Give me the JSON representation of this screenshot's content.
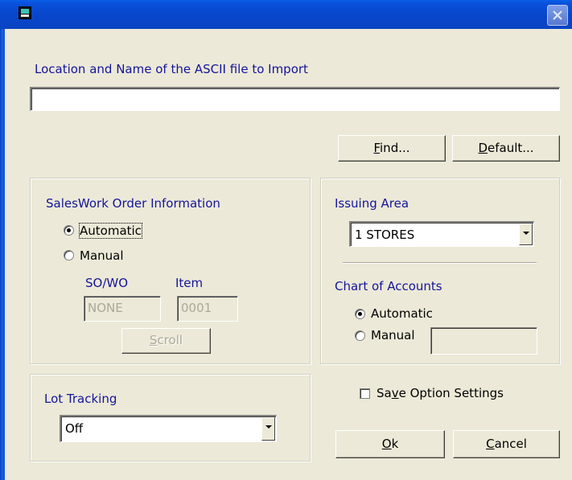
{
  "window": {
    "title": "",
    "icon": "app-icon",
    "close_icon": "close-icon"
  },
  "import": {
    "label": "Location and Name of the ASCII file to Import",
    "path_value": "",
    "find_prefix": "",
    "find_ul": "F",
    "find_rest": "ind...",
    "default_ul": "D",
    "default_rest": "efault..."
  },
  "sales": {
    "heading": "SalesWork Order Information",
    "automatic_label": "Automatic",
    "automatic_checked": true,
    "manual_label": "Manual",
    "so_wo_label": "SO/WO",
    "item_label": "Item",
    "so_wo_value": "NONE",
    "item_value": "0001",
    "scroll_ul": "S",
    "scroll_rest": "croll"
  },
  "issuing": {
    "heading": "Issuing Area",
    "selected": "1 STORES"
  },
  "accounts": {
    "heading": "Chart of Accounts",
    "automatic_label": "Automatic",
    "automatic_checked": true,
    "manual_label": "Manual",
    "manual_value": ""
  },
  "lot": {
    "heading": "Lot Tracking",
    "selected": "Off"
  },
  "options": {
    "save_prefix": "Sa",
    "save_ul": "v",
    "save_rest": "e Option Settings",
    "save_checked": false
  },
  "actions": {
    "ok_ul": "O",
    "ok_rest": "k",
    "cancel_ul": "C",
    "cancel_rest": "ancel"
  },
  "colors": {
    "dialog_bg": "#ece9d8",
    "label_blue": "#14149a",
    "titlebar_blue": "#0745c9"
  }
}
